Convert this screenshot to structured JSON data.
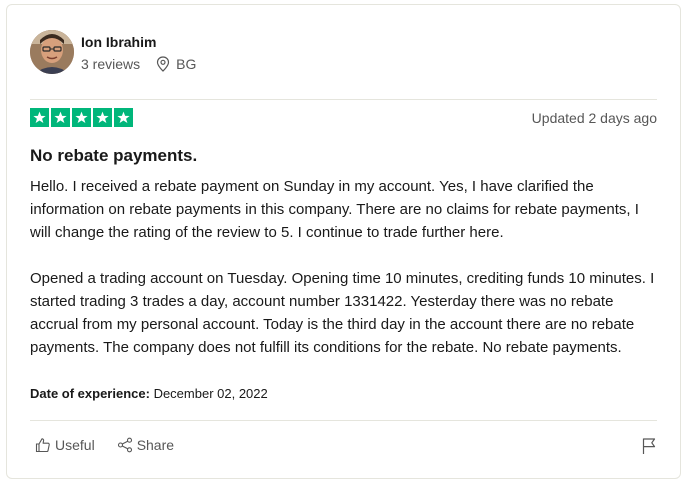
{
  "consumer": {
    "name": "Ion Ibrahim",
    "reviews_count": "3 reviews",
    "country": "BG"
  },
  "review": {
    "rating": 5,
    "star_color": "#00b67a",
    "updated": "Updated 2 days ago",
    "title": "No rebate payments.",
    "paragraph_1": "Hello. I received a rebate payment on Sunday in my account. Yes, I have clarified the information on rebate payments in this company. There are no claims for rebate payments, I will change the rating of the review to 5. I continue to trade further here.",
    "paragraph_2": "Opened a trading account on Tuesday. Opening time 10 minutes, crediting funds 10 minutes. I started trading 3 trades a day, account number 1331422. Yesterday there was no rebate accrual from my personal account. Today is the third day in the account there are no rebate payments. The company does not fulfill its conditions for the rebate. No rebate payments.",
    "experience_label": "Date of experience:",
    "experience_date": "December 02, 2022"
  },
  "actions": {
    "useful_label": "Useful",
    "share_label": "Share"
  },
  "icons": {
    "avatar": "avatar-photo",
    "location": "location-pin-icon",
    "star": "star-icon",
    "useful": "thumbs-up-icon",
    "share": "share-icon",
    "report": "flag-icon"
  }
}
